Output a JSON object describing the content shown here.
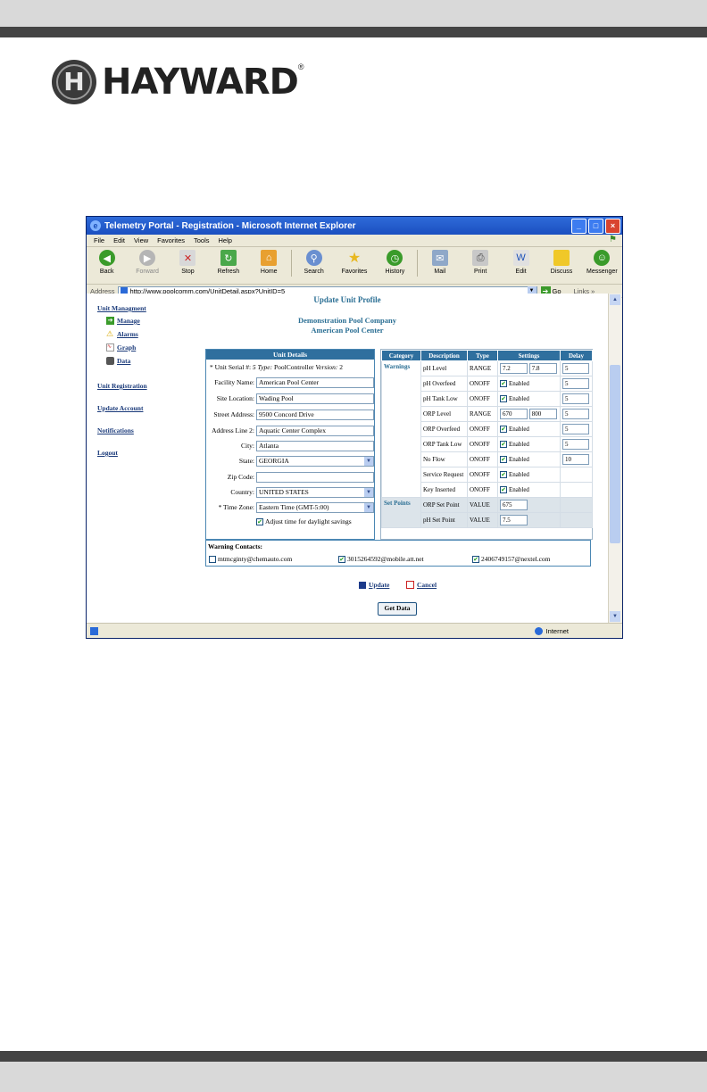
{
  "brand": {
    "name": "HAYWARD",
    "mark": "H",
    "reg": "®"
  },
  "window": {
    "title": "Telemetry Portal - Registration - Microsoft Internet Explorer",
    "menu": [
      "File",
      "Edit",
      "View",
      "Favorites",
      "Tools",
      "Help"
    ],
    "toolbar": {
      "back": "Back",
      "forward": "Forward",
      "stop": "Stop",
      "refresh": "Refresh",
      "home": "Home",
      "search": "Search",
      "favorites": "Favorites",
      "history": "History",
      "mail": "Mail",
      "print": "Print",
      "edit": "Edit",
      "discuss": "Discuss",
      "messenger": "Messenger"
    },
    "address_label": "Address",
    "url": "http://www.poolcomm.com/UnitDetail.aspx?UnitID=5",
    "go": "Go",
    "links": "Links",
    "status_zone": "Internet"
  },
  "sidebar": {
    "unit_management": "Unit Managment",
    "manage": "Manage",
    "alarms": "Alarms",
    "graph": "Graph",
    "data": "Data",
    "unit_registration": "Unit Registration",
    "update_account": "Update Account",
    "notifications": "Notifications",
    "logout": "Logout"
  },
  "page": {
    "title": "Update Unit Profile",
    "company": "Demonstration Pool Company",
    "site": "American Pool Center"
  },
  "unit_details": {
    "header": "Unit Details",
    "serial_label": "* Unit Serial #:",
    "serial": "5",
    "type_label": "Type:",
    "type": "PoolController",
    "version_label": "Version:",
    "version": "2",
    "facility_label": "Facility Name:",
    "facility": "American Pool Center",
    "site_label": "Site Location:",
    "site": "Wading Pool",
    "street_label": "Street Address:",
    "street": "9500 Concord Drive",
    "addr2_label": "Address Line 2:",
    "addr2": "Aquatic Center Complex",
    "city_label": "City:",
    "city": "Atlanta",
    "state_label": "State:",
    "state": "GEORGIA",
    "zip_label": "Zip Code:",
    "zip": "",
    "country_label": "Country:",
    "country": "UNITED STATES",
    "tz_label": "* Time Zone:",
    "tz": "Eastern Time (GMT-5:00)",
    "dst_label": "Adjust time for daylight savings"
  },
  "warnings_table": {
    "headers": [
      "Category",
      "Description",
      "Type",
      "Settings",
      "Delay"
    ],
    "warnings_label": "Warnings",
    "setpoints_label": "Set Points",
    "enabled": "Enabled",
    "rows": [
      {
        "desc": "pH Level",
        "type": "RANGE",
        "low": "7.2",
        "high": "7.8",
        "delay": "5"
      },
      {
        "desc": "pH Overfeed",
        "type": "ONOFF",
        "delay": "5"
      },
      {
        "desc": "pH Tank Low",
        "type": "ONOFF",
        "delay": "5"
      },
      {
        "desc": "ORP Level",
        "type": "RANGE",
        "low": "670",
        "high": "800",
        "delay": "5"
      },
      {
        "desc": "ORP Overfeed",
        "type": "ONOFF",
        "delay": "5"
      },
      {
        "desc": "ORP Tank Low",
        "type": "ONOFF",
        "delay": "5"
      },
      {
        "desc": "No Flow",
        "type": "ONOFF",
        "delay": "10"
      },
      {
        "desc": "Service Request",
        "type": "ONOFF"
      },
      {
        "desc": "Key Inserted",
        "type": "ONOFF"
      }
    ],
    "setpoints": [
      {
        "desc": "ORP Set Point",
        "type": "VALUE",
        "value": "675"
      },
      {
        "desc": "pH Set Point",
        "type": "VALUE",
        "value": "7.5"
      }
    ]
  },
  "contacts": {
    "title": "Warning Contacts:",
    "items": [
      {
        "email": "mtmcginty@chemauto.com",
        "checked": false
      },
      {
        "email": "3015264592@mobile.att.net",
        "checked": true
      },
      {
        "email": "2406749157@nextel.com",
        "checked": true
      }
    ]
  },
  "actions": {
    "update": "Update",
    "cancel": "Cancel",
    "get_data": "Get Data"
  },
  "colors": {
    "header_blue": "#2f6f9e",
    "title_teal": "#2b6f94",
    "xp_title": "#1b4fc0"
  }
}
